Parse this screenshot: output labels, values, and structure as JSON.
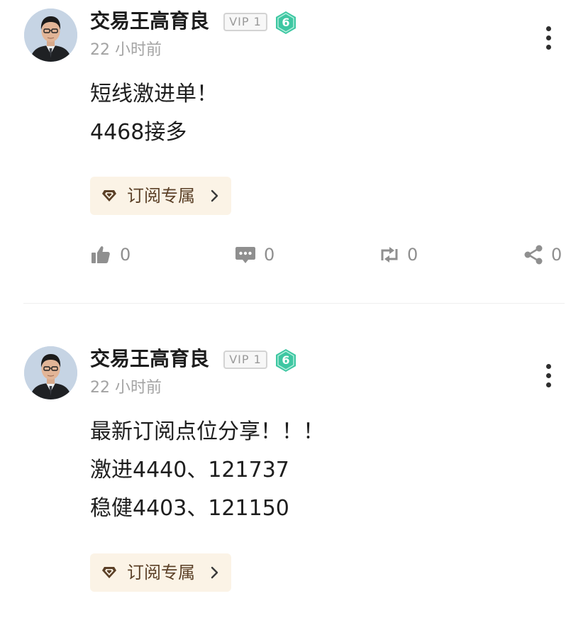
{
  "colors": {
    "accent_bg": "#fbf3e6",
    "accent_text": "#5b4027",
    "level_badge": "#3ec7a2",
    "muted": "#a3a3a3"
  },
  "posts": [
    {
      "author": "交易王高育良",
      "vip": "VIP 1",
      "level": "6",
      "time": "22 小时前",
      "lines": [
        "短线激进单！",
        "4468接多"
      ],
      "subscribe_label": "订阅专属",
      "actions": {
        "like": "0",
        "comment": "0",
        "repost": "0",
        "share": "0"
      },
      "icons": [
        "avatar",
        "diamond-icon",
        "chevron-right-icon",
        "thumbs-up-icon",
        "comment-icon",
        "repost-icon",
        "share-icon",
        "more-icon"
      ]
    },
    {
      "author": "交易王高育良",
      "vip": "VIP 1",
      "level": "6",
      "time": "22 小时前",
      "lines": [
        "最新订阅点位分享！！！",
        "激进4440、121737",
        "稳健4403、121150"
      ],
      "subscribe_label": "订阅专属",
      "icons": [
        "avatar",
        "diamond-icon",
        "chevron-right-icon",
        "more-icon"
      ]
    }
  ]
}
